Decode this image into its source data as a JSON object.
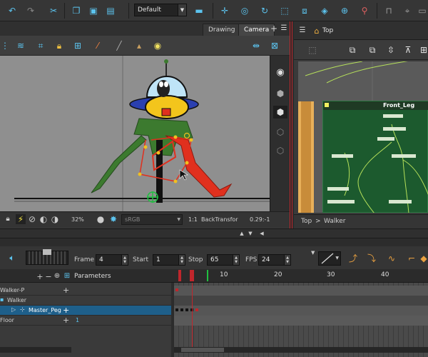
{
  "toolbar": {
    "preset": "Default",
    "icons": [
      "undo-icon",
      "redo-icon",
      "cut-icon",
      "copy-icon",
      "paste-icon",
      "delete-icon",
      "layout-icon",
      "transform-icon",
      "pivot-icon",
      "rotate-icon",
      "scale-icon",
      "skew-icon",
      "morph-icon",
      "reposition-icon",
      "pin-icon",
      "ik-icon"
    ]
  },
  "view": {
    "tabs": [
      "Drawing",
      "Camera"
    ],
    "active_tab": "Camera",
    "status": {
      "zoom": "32%",
      "color_space": "sRGB",
      "ratio": "1:1",
      "tool": "BackTransfor",
      "value": "0.29:-1"
    }
  },
  "node_view": {
    "title": "Top",
    "group_name": "Front_Leg",
    "breadcrumb": [
      "Top",
      "Walker"
    ],
    "breadcrumb_sep": ">"
  },
  "timeline": {
    "frame_label": "Frame",
    "frame_value": "4",
    "start_label": "Start",
    "start_value": "1",
    "stop_label": "Stop",
    "stop_value": "65",
    "fps_label": "FPS",
    "fps_value": "24",
    "parameters_label": "Parameters",
    "ruler_numbers": [
      "10",
      "20",
      "30",
      "40"
    ],
    "layers": [
      {
        "name": "Walker-P",
        "selected": false
      },
      {
        "name": "Walker",
        "selected": false
      },
      {
        "name": "Master_Peg",
        "selected": true
      },
      {
        "name": "Floor",
        "selected": false,
        "value": "1"
      }
    ]
  },
  "colors": {
    "accent": "#5cc4ef",
    "red_split": "#c0262c",
    "node_group_bg": "#1c5a2e",
    "rig_red": "#e0301e",
    "rig_green": "#3c7a2f"
  }
}
